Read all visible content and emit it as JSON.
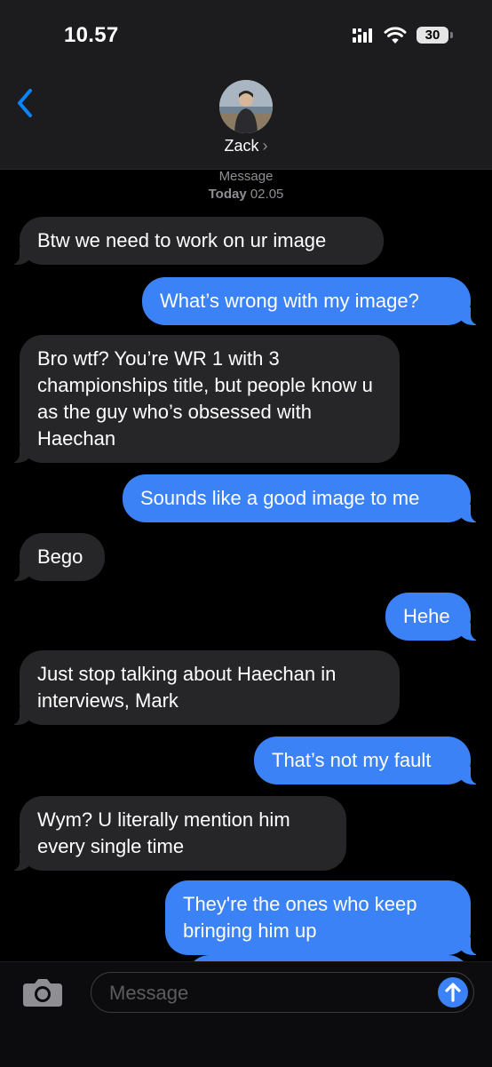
{
  "status_bar": {
    "time": "10.57",
    "battery": "30"
  },
  "header": {
    "contact_name": "Zack",
    "chevron": "›"
  },
  "thread": {
    "service": "Message",
    "day": "Today",
    "time": "02.05",
    "messages": [
      {
        "side": "incoming",
        "text": "Btw we need to work on ur image"
      },
      {
        "side": "outgoing",
        "text": "What’s wrong with my image?"
      },
      {
        "side": "incoming",
        "text": "Bro wtf? You’re WR 1 with 3 championships title, but people know u as the guy who’s obsessed with Haechan"
      },
      {
        "side": "outgoing",
        "text": "Sounds like a good image to me"
      },
      {
        "side": "incoming",
        "text": "Bego"
      },
      {
        "side": "outgoing",
        "text": "Hehe"
      },
      {
        "side": "incoming",
        "text": "Just stop talking about Haechan in interviews, Mark"
      },
      {
        "side": "outgoing",
        "text": "That’s not my fault"
      },
      {
        "side": "incoming",
        "text": "Wym? U literally mention him every single time"
      },
      {
        "side": "outgoing",
        "text": "They're the ones who keep bringing him up"
      }
    ]
  },
  "composer": {
    "placeholder": "Message"
  },
  "colors": {
    "outgoing_bubble": "#3b82f6",
    "incoming_bubble": "#262628",
    "accent": "#0a84ff"
  }
}
